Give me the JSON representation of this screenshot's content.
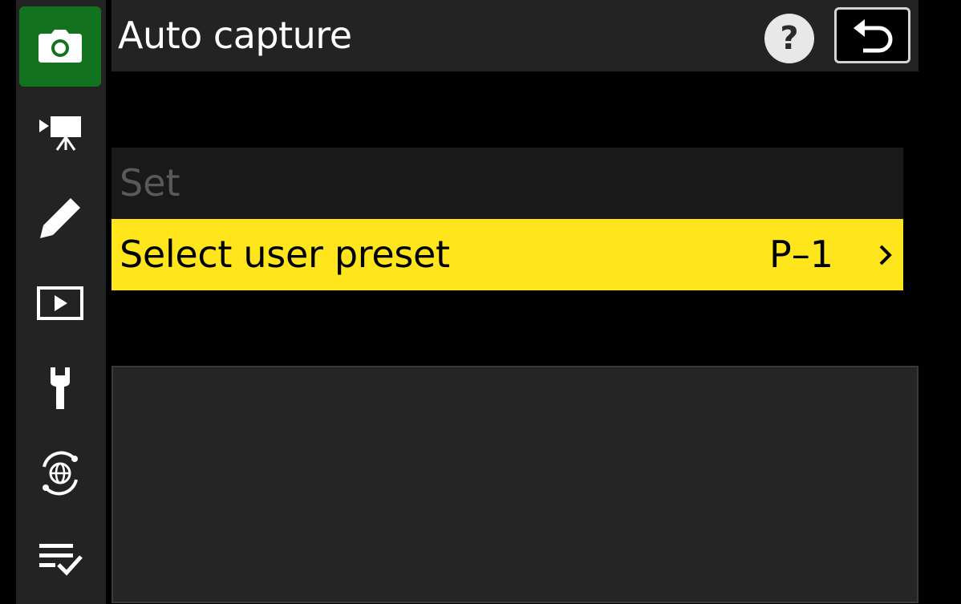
{
  "header": {
    "title": "Auto capture",
    "help_label": "?"
  },
  "sidebar": {
    "items": [
      {
        "icon": "camera-icon",
        "active": true
      },
      {
        "icon": "movie-camera-icon",
        "active": false
      },
      {
        "icon": "pencil-icon",
        "active": false
      },
      {
        "icon": "playback-icon",
        "active": false
      },
      {
        "icon": "wrench-icon",
        "active": false
      },
      {
        "icon": "network-globe-icon",
        "active": false
      },
      {
        "icon": "my-menu-checklist-icon",
        "active": false
      }
    ]
  },
  "menu": {
    "set_label": "Set",
    "preset_label": "Select user preset",
    "preset_value": "P–1"
  },
  "colors": {
    "background": "#000000",
    "panel": "#232323",
    "active_tab": "#12721e",
    "highlight": "#ffe51c",
    "disabled_text": "#595959"
  }
}
